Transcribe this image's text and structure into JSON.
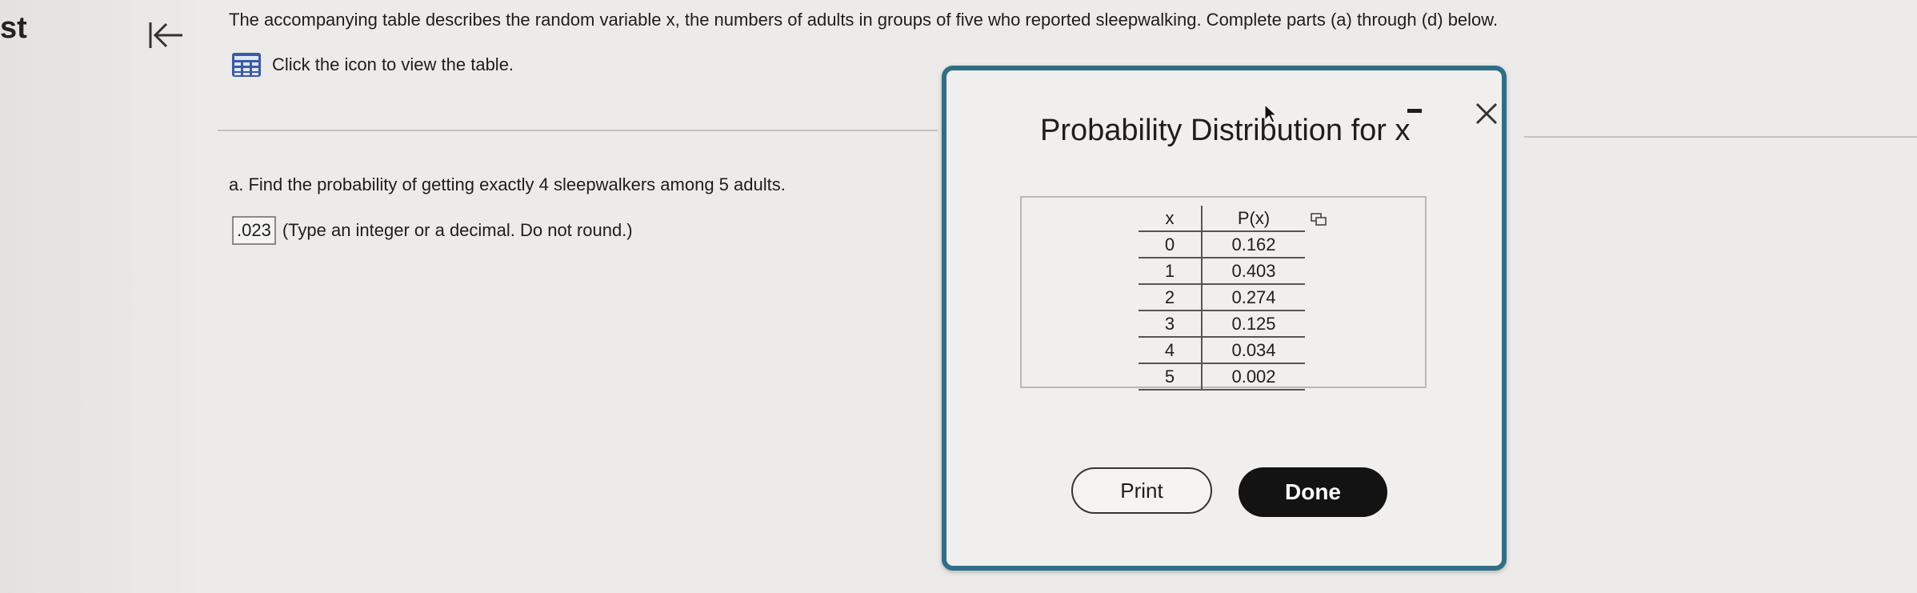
{
  "edge_text": "st",
  "header": {
    "intro": "The accompanying table describes the random variable x, the numbers of adults in groups of five who reported sleepwalking. Complete parts (a) through (d) below.",
    "table_link": "Click the icon to view the table."
  },
  "question_a": {
    "prompt": "a. Find the probability of getting exactly 4 sleepwalkers among 5 adults.",
    "answer": ".023",
    "hint": "(Type an integer or a decimal. Do not round.)"
  },
  "dialog": {
    "title": "Probability Distribution for x",
    "headers": [
      "x",
      "P(x)"
    ],
    "rows": [
      {
        "x": "0",
        "p": "0.162"
      },
      {
        "x": "1",
        "p": "0.403"
      },
      {
        "x": "2",
        "p": "0.274"
      },
      {
        "x": "3",
        "p": "0.125"
      },
      {
        "x": "4",
        "p": "0.034"
      },
      {
        "x": "5",
        "p": "0.002"
      }
    ],
    "print_label": "Print",
    "done_label": "Done"
  },
  "colors": {
    "dialog_border": "#2f6e86",
    "done_bg": "#131313",
    "grid_icon": "#3b5aa8"
  },
  "icons": [
    "back-to-start-icon",
    "table-grid-icon",
    "minimize-icon",
    "close-icon",
    "copy-icon"
  ]
}
